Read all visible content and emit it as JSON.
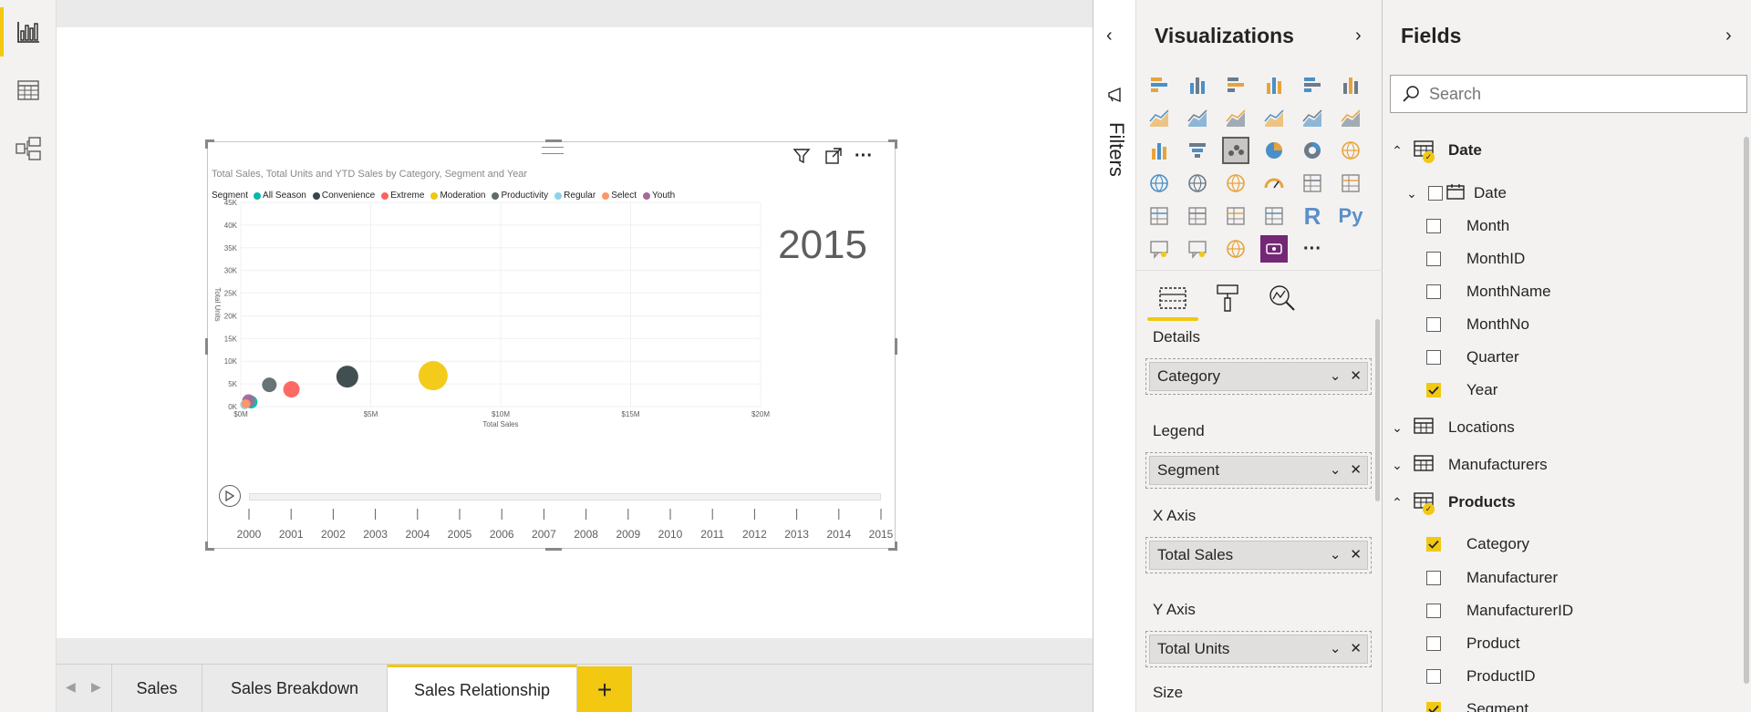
{
  "left_rail": {
    "items": [
      {
        "name": "report-view",
        "icon": "bar-chart-icon",
        "active": true
      },
      {
        "name": "data-view",
        "icon": "table-icon",
        "active": false
      },
      {
        "name": "model-view",
        "icon": "model-icon",
        "active": false
      }
    ]
  },
  "visual": {
    "title": "Total Sales, Total Units and YTD Sales by Category, Segment and Year",
    "legend_title": "Segment",
    "legend": [
      {
        "name": "All Season",
        "color": "#01b8aa"
      },
      {
        "name": "Convenience",
        "color": "#374649"
      },
      {
        "name": "Extreme",
        "color": "#fd625e"
      },
      {
        "name": "Moderation",
        "color": "#f2c80f"
      },
      {
        "name": "Productivity",
        "color": "#5f6b6d"
      },
      {
        "name": "Regular",
        "color": "#8ad4eb"
      },
      {
        "name": "Select",
        "color": "#fe9666"
      },
      {
        "name": "Youth",
        "color": "#a66999"
      }
    ],
    "year_overlay": "2015",
    "header_icons": [
      "filter-icon",
      "focus-mode-icon",
      "more-options-icon"
    ]
  },
  "chart_data": {
    "type": "scatter",
    "title": "Total Sales, Total Units and YTD Sales by Category, Segment and Year",
    "xlabel": "Total Sales",
    "ylabel": "Total Units",
    "x_ticks": [
      "$0M",
      "$5M",
      "$10M",
      "$15M",
      "$20M"
    ],
    "y_ticks": [
      "0K",
      "5K",
      "10K",
      "15K",
      "20K",
      "25K",
      "30K",
      "35K",
      "40K",
      "45K"
    ],
    "xlim": [
      0,
      20
    ],
    "ylim": [
      0,
      45000
    ],
    "x_unit": "$M",
    "play_axis": [
      "2000",
      "2001",
      "2002",
      "2003",
      "2004",
      "2005",
      "2006",
      "2007",
      "2008",
      "2009",
      "2010",
      "2011",
      "2012",
      "2013",
      "2014",
      "2015"
    ],
    "play_current": "2015",
    "points": [
      {
        "segment": "Moderation",
        "x": 7.4,
        "y": 6800,
        "size": 16,
        "color": "#f2c80f"
      },
      {
        "segment": "Convenience",
        "x": 4.1,
        "y": 6600,
        "size": 12,
        "color": "#374649"
      },
      {
        "segment": "Extreme",
        "x": 1.95,
        "y": 3800,
        "size": 9,
        "color": "#fd625e"
      },
      {
        "segment": "Productivity",
        "x": 1.1,
        "y": 4800,
        "size": 8,
        "color": "#5f6b6d"
      },
      {
        "segment": "All Season",
        "x": 0.4,
        "y": 1000,
        "size": 7,
        "color": "#01b8aa"
      },
      {
        "segment": "Youth",
        "x": 0.3,
        "y": 1300,
        "size": 7,
        "color": "#a66999"
      },
      {
        "segment": "Regular",
        "x": 0.15,
        "y": 400,
        "size": 5,
        "color": "#8ad4eb"
      },
      {
        "segment": "Select",
        "x": 0.2,
        "y": 600,
        "size": 5,
        "color": "#fe9666"
      }
    ]
  },
  "page_tabs": {
    "tabs": [
      {
        "label": "Sales",
        "active": false
      },
      {
        "label": "Sales Breakdown",
        "active": false
      },
      {
        "label": "Sales Relationship",
        "active": true
      }
    ],
    "add_label": "+"
  },
  "filters": {
    "label": "Filters"
  },
  "visualizations": {
    "title": "Visualizations",
    "icons": [
      "stacked-bar-icon",
      "stacked-column-icon",
      "clustered-bar-icon",
      "clustered-column-icon",
      "100-bar-icon",
      "100-column-icon",
      "line-chart-icon",
      "area-chart-icon",
      "stacked-area-icon",
      "line-column-icon",
      "line-clustered-column-icon",
      "ribbon-chart-icon",
      "waterfall-icon",
      "funnel-icon",
      "scatter-icon",
      "pie-chart-icon",
      "donut-chart-icon",
      "treemap-icon",
      "map-icon",
      "filled-map-icon",
      "shape-map-icon",
      "gauge-icon",
      "card-icon",
      "multi-row-card-icon",
      "kpi-icon",
      "slicer-icon",
      "table-icon",
      "matrix-icon",
      "r-visual-icon",
      "python-visual-icon",
      "key-influencers-icon",
      "qa-icon",
      "arcgis-icon",
      "custom-visual-icon",
      "more-visuals-icon"
    ],
    "r_label": "R",
    "py_label": "Py",
    "more_label": "···",
    "wells": [
      {
        "label": "Details",
        "field": "Category"
      },
      {
        "label": "Legend",
        "field": "Segment"
      },
      {
        "label": "X Axis",
        "field": "Total Sales"
      },
      {
        "label": "Y Axis",
        "field": "Total Units"
      },
      {
        "label": "Size",
        "field": ""
      }
    ]
  },
  "fields": {
    "title": "Fields",
    "search_placeholder": "Search",
    "tables": [
      {
        "name": "Date",
        "expanded": true,
        "active": true
      },
      {
        "name": "Locations",
        "expanded": false,
        "active": false
      },
      {
        "name": "Manufacturers",
        "expanded": false,
        "active": false
      },
      {
        "name": "Products",
        "expanded": true,
        "active": true
      }
    ],
    "date_hierarchy": "Date",
    "date_fields": [
      {
        "name": "Month",
        "checked": false
      },
      {
        "name": "MonthID",
        "checked": false
      },
      {
        "name": "MonthName",
        "checked": false
      },
      {
        "name": "MonthNo",
        "checked": false
      },
      {
        "name": "Quarter",
        "checked": false
      },
      {
        "name": "Year",
        "checked": true
      }
    ],
    "product_fields": [
      {
        "name": "Category",
        "checked": true
      },
      {
        "name": "Manufacturer",
        "checked": false
      },
      {
        "name": "ManufacturerID",
        "checked": false
      },
      {
        "name": "Product",
        "checked": false
      },
      {
        "name": "ProductID",
        "checked": false
      },
      {
        "name": "Segment",
        "checked": true
      }
    ]
  }
}
